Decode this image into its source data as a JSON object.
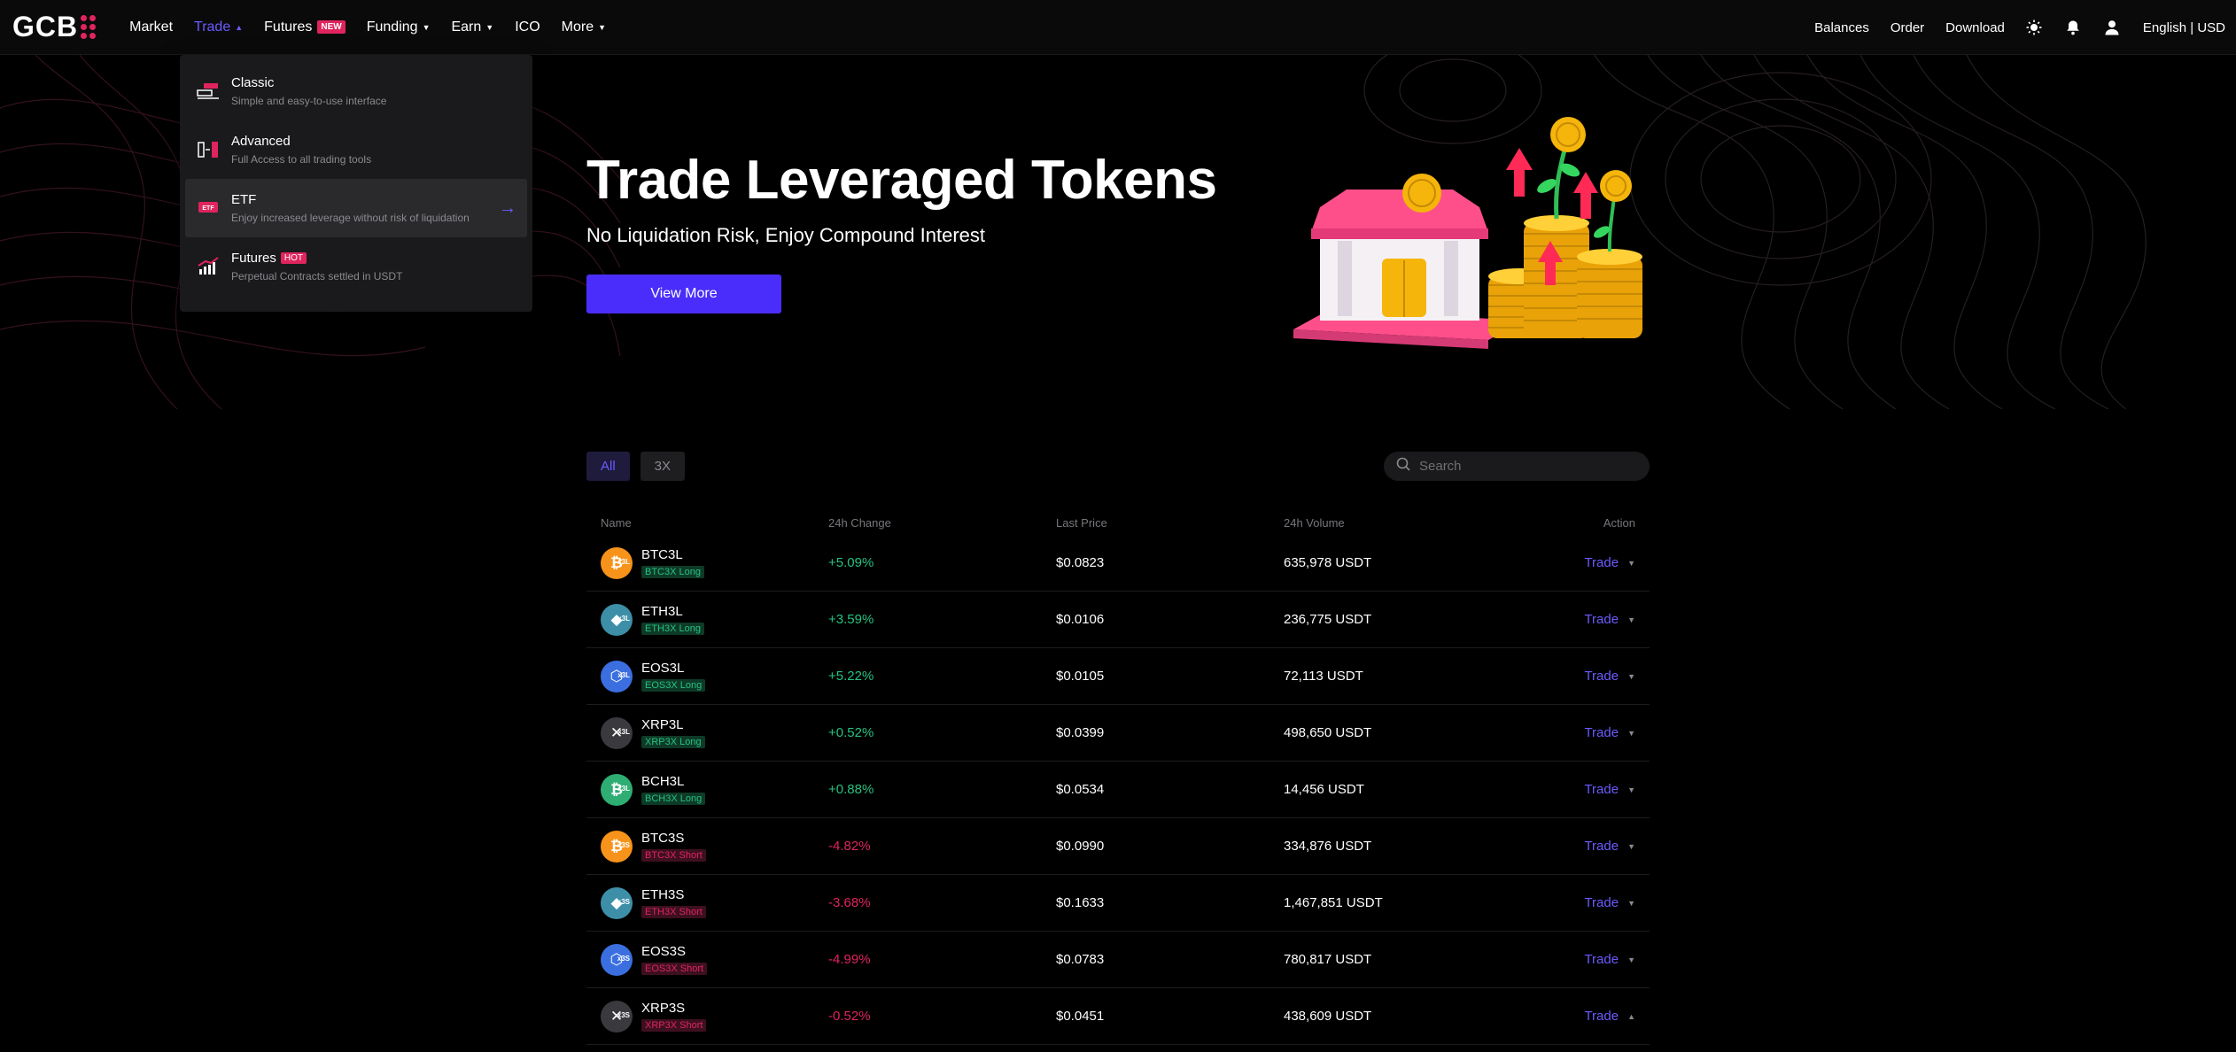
{
  "nav": {
    "logo": "GCB",
    "items": [
      {
        "label": "Market"
      },
      {
        "label": "Trade"
      },
      {
        "label": "Futures",
        "badge": "NEW"
      },
      {
        "label": "Funding"
      },
      {
        "label": "Earn"
      },
      {
        "label": "ICO"
      },
      {
        "label": "More"
      }
    ],
    "right": {
      "balances": "Balances",
      "order": "Order",
      "download": "Download",
      "lang": "English | USD"
    }
  },
  "trade_menu": {
    "items": [
      {
        "title": "Classic",
        "desc": "Simple and easy-to-use interface"
      },
      {
        "title": "Advanced",
        "desc": "Full Access to all trading tools"
      },
      {
        "title": "ETF",
        "desc": "Enjoy increased leverage without risk of liquidation"
      },
      {
        "title": "Futures",
        "badge": "HOT",
        "desc": "Perpetual Contracts settled in USDT"
      }
    ]
  },
  "hero": {
    "title": "Trade Leveraged Tokens",
    "subtitle": "No Liquidation Risk, Enjoy Compound Interest",
    "button": "View More"
  },
  "filters": {
    "all": "All",
    "x3": "3X",
    "search_placeholder": "Search"
  },
  "table": {
    "headers": {
      "name": "Name",
      "change": "24h Change",
      "price": "Last Price",
      "volume": "24h Volume",
      "action": "Action"
    },
    "rows": [
      {
        "symbol": "BTC3L",
        "tag": "BTC3X Long",
        "change": "+5.09%",
        "price": "$0.0823",
        "volume": "635,978 USDT",
        "action": "Trade"
      },
      {
        "symbol": "ETH3L",
        "tag": "ETH3X Long",
        "change": "+3.59%",
        "price": "$0.0106",
        "volume": "236,775 USDT",
        "action": "Trade"
      },
      {
        "symbol": "EOS3L",
        "tag": "EOS3X Long",
        "change": "+5.22%",
        "price": "$0.0105",
        "volume": "72,113 USDT",
        "action": "Trade"
      },
      {
        "symbol": "XRP3L",
        "tag": "XRP3X Long",
        "change": "+0.52%",
        "price": "$0.0399",
        "volume": "498,650 USDT",
        "action": "Trade"
      },
      {
        "symbol": "BCH3L",
        "tag": "BCH3X Long",
        "change": "+0.88%",
        "price": "$0.0534",
        "volume": "14,456 USDT",
        "action": "Trade"
      },
      {
        "symbol": "BTC3S",
        "tag": "BTC3X Short",
        "change": "-4.82%",
        "price": "$0.0990",
        "volume": "334,876 USDT",
        "action": "Trade"
      },
      {
        "symbol": "ETH3S",
        "tag": "ETH3X Short",
        "change": "-3.68%",
        "price": "$0.1633",
        "volume": "1,467,851 USDT",
        "action": "Trade"
      },
      {
        "symbol": "EOS3S",
        "tag": "EOS3X Short",
        "change": "-4.99%",
        "price": "$0.0783",
        "volume": "780,817 USDT",
        "action": "Trade"
      },
      {
        "symbol": "XRP3S",
        "tag": "XRP3X Short",
        "change": "-0.52%",
        "price": "$0.0451",
        "volume": "438,609 USDT",
        "action": "Trade"
      }
    ]
  },
  "coin_icons": [
    "bitcoin-icon",
    "ethereum-icon",
    "eos-icon",
    "xrp-icon",
    "bch-icon",
    "bitcoin-icon",
    "ethereum-icon",
    "eos-icon",
    "xrp-icon"
  ],
  "colors": {
    "accent": "#4a2dfa",
    "link": "#6b5bff",
    "up": "#26c281",
    "down": "#e0245e",
    "brand": "#e0245e"
  }
}
